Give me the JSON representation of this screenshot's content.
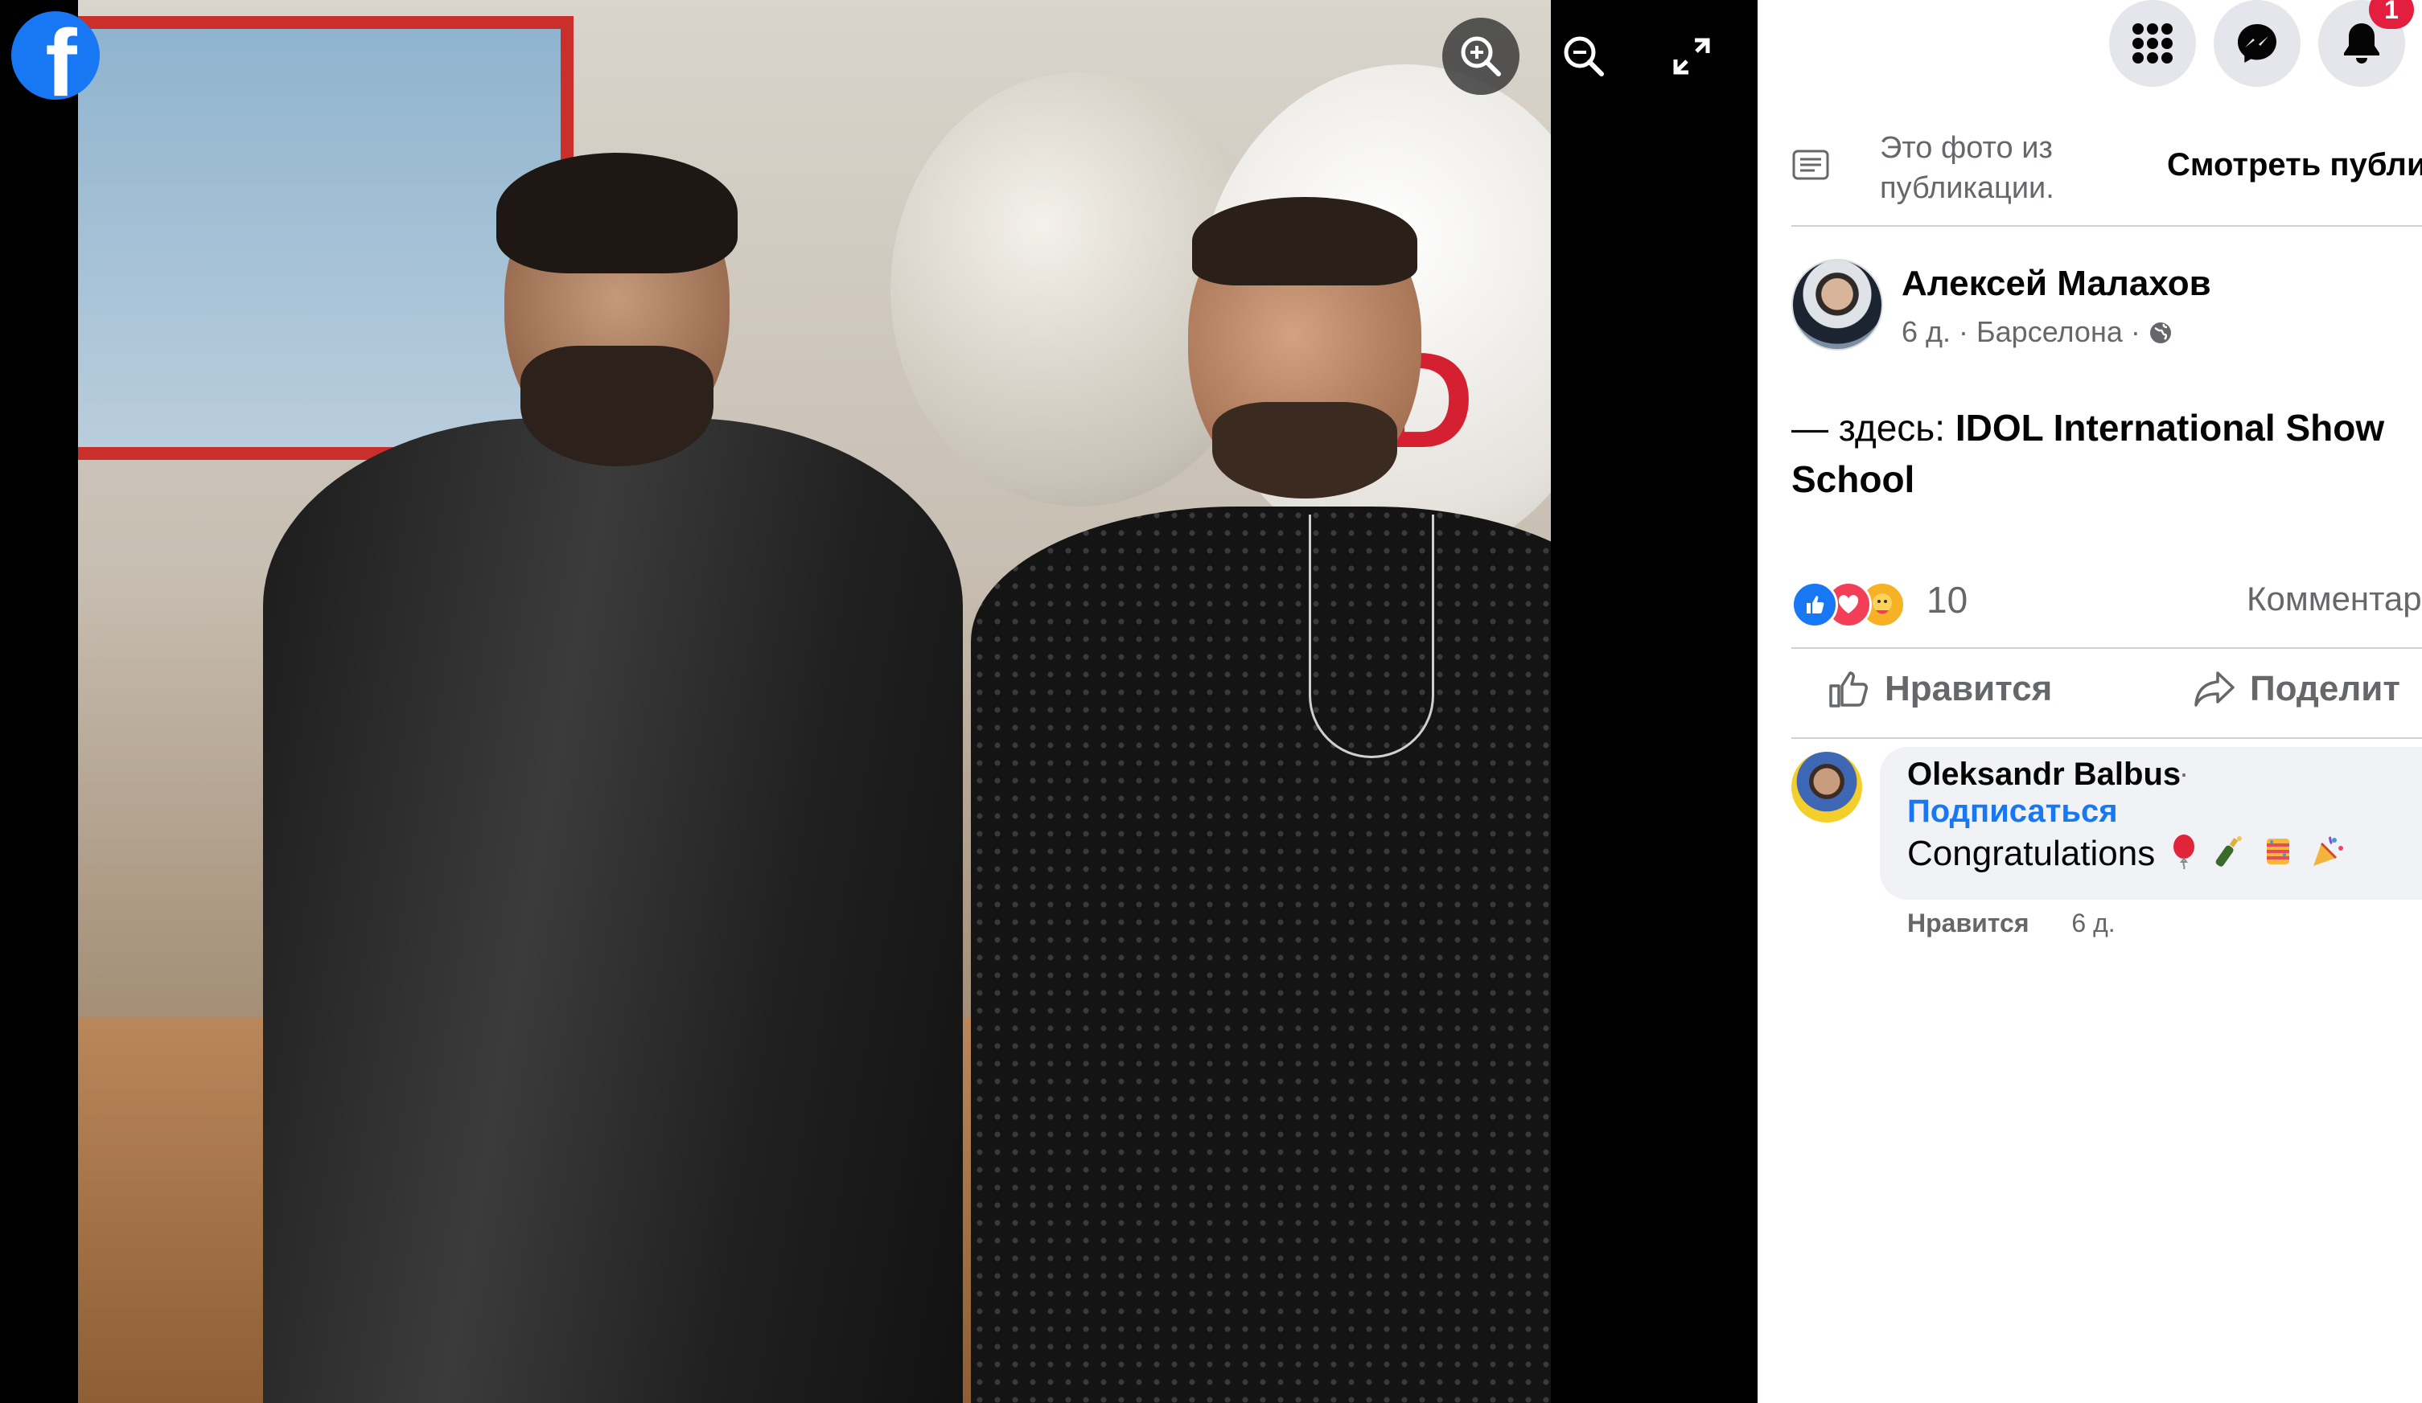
{
  "viewer": {
    "logo_icon": "facebook-logo",
    "logo_glyph": "f",
    "zoom_in_icon": "zoom-in-icon",
    "zoom_out_icon": "zoom-out-icon",
    "fullscreen_icon": "fullscreen-icon",
    "photo_text": "ID"
  },
  "topbar": {
    "menu_icon": "grid-menu-icon",
    "messenger_icon": "messenger-icon",
    "notifications_icon": "bell-icon",
    "notifications_count": "1"
  },
  "from_post": {
    "icon": "post-note-icon",
    "text": "Это фото из публикации.",
    "link": "Смотреть публик"
  },
  "author": {
    "name": "Алексей Малахов",
    "meta": "6 д. · Барселона ·",
    "privacy_icon": "globe-icon"
  },
  "post": {
    "prefix": "— здесь: ",
    "location_link": "IDOL International Show School"
  },
  "reactions": {
    "icons": [
      "like-icon",
      "love-icon",
      "care-icon"
    ],
    "count": "10",
    "comments_link": "Комментар"
  },
  "actions": {
    "like_label": "Нравится",
    "share_label": "Поделит"
  },
  "comment": {
    "author": "Oleksandr Balbus",
    "dot": "·",
    "follow": "Подписаться",
    "text": "Congratulations",
    "emojis": [
      "balloon-emoji",
      "champagne-emoji",
      "confetti-ball-emoji",
      "party-popper-emoji"
    ],
    "like_label": "Нравится",
    "time": "6 д."
  },
  "colors": {
    "facebook_blue": "#1877f2",
    "badge_red": "#e41e3f",
    "secondary_text": "#65676b"
  }
}
